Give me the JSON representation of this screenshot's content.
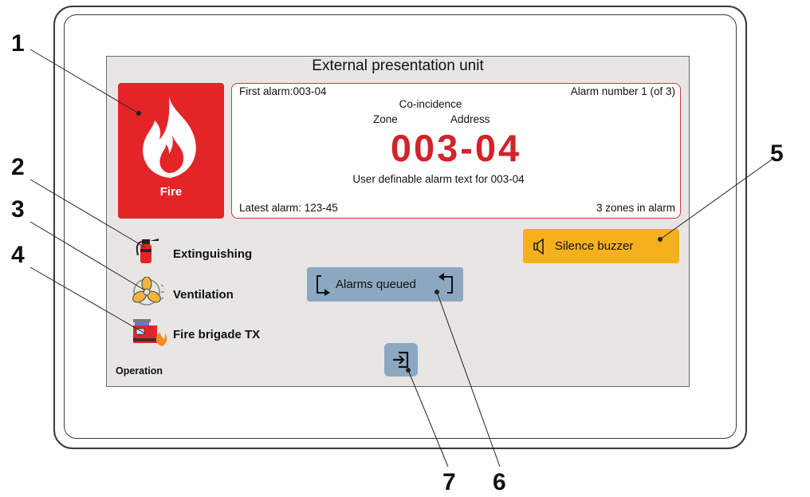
{
  "screen": {
    "title": "External presentation unit",
    "fire_tile": {
      "label": "Fire",
      "icon": "flame-icon"
    },
    "alarm": {
      "first_alarm": "First alarm:003-04",
      "alarm_number": "Alarm number 1 (of 3)",
      "mode": "Co-incidence",
      "zone_label": "Zone",
      "address_label": "Address",
      "zone_address": "003-04",
      "alarm_text": "User definable alarm text for 003-04",
      "latest_alarm": "Latest alarm: 123-45",
      "zones_in_alarm": "3 zones in alarm"
    },
    "indicators": [
      {
        "label": "Extinguishing",
        "icon": "fire-extinguisher-icon"
      },
      {
        "label": "Ventilation",
        "icon": "fan-icon"
      },
      {
        "label": "Fire brigade TX",
        "icon": "fire-truck-icon"
      }
    ],
    "operation_label": "Operation",
    "silence_button": {
      "label": "Silence buzzer",
      "icon": "speaker-icon"
    },
    "queue_button": {
      "label": "Alarms queued",
      "icon": "cycle-arrows-icon"
    },
    "exit_button": {
      "icon": "exit-icon"
    },
    "colors": {
      "fire_red": "#e42527",
      "alarm_text_red": "#d2232a",
      "silence_orange": "#f6b01c",
      "button_blue": "#8ca8c0",
      "screen_grey": "#e7e6e5"
    }
  },
  "callouts": [
    "1",
    "2",
    "3",
    "4",
    "5",
    "6",
    "7"
  ]
}
